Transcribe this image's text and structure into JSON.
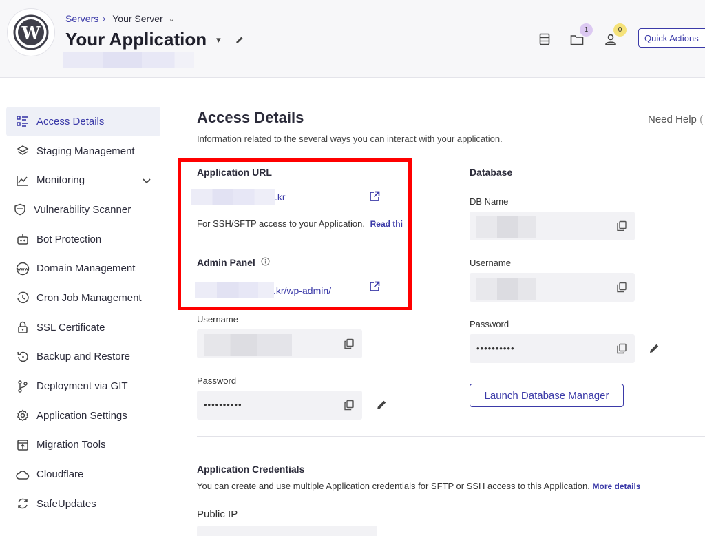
{
  "header": {
    "breadcrumb_servers": "Servers",
    "breadcrumb_server": "Your Server",
    "app_title": "Your Application",
    "notifications_count": "1",
    "users_count": "0",
    "quick_actions": "Quick Actions"
  },
  "sidebar": {
    "items": [
      {
        "label": "Access Details",
        "icon": "list-icon"
      },
      {
        "label": "Staging Management",
        "icon": "layers-icon"
      },
      {
        "label": "Monitoring",
        "icon": "chart-icon"
      },
      {
        "label": "Vulnerability Scanner",
        "icon": "shield-scan-icon"
      },
      {
        "label": "Bot Protection",
        "icon": "bot-icon"
      },
      {
        "label": "Domain Management",
        "icon": "www-icon"
      },
      {
        "label": "Cron Job Management",
        "icon": "clock-icon"
      },
      {
        "label": "SSL Certificate",
        "icon": "lock-icon"
      },
      {
        "label": "Backup and Restore",
        "icon": "restore-icon"
      },
      {
        "label": "Deployment via GIT",
        "icon": "git-icon"
      },
      {
        "label": "Application Settings",
        "icon": "gear-icon"
      },
      {
        "label": "Migration Tools",
        "icon": "migration-icon"
      },
      {
        "label": "Cloudflare",
        "icon": "cloud-icon"
      },
      {
        "label": "SafeUpdates",
        "icon": "refresh-icon"
      }
    ]
  },
  "main": {
    "title": "Access Details",
    "subtitle": "Information related to the several ways you can interact with your application.",
    "need_help": "Need Help",
    "app_url": {
      "label": "Application URL",
      "url_suffix": ".kr",
      "ssh_note": "For SSH/SFTP access to your Application.",
      "read_link": "Read thi"
    },
    "admin_panel": {
      "label": "Admin Panel",
      "url_suffix": ".kr/wp-admin/"
    },
    "app_username_label": "Username",
    "app_password_label": "Password",
    "app_password_value": "••••••••••",
    "database": {
      "label": "Database",
      "db_name_label": "DB Name",
      "username_label": "Username",
      "password_label": "Password",
      "password_value": "••••••••••",
      "launch_button": "Launch Database Manager"
    },
    "credentials": {
      "title": "Application Credentials",
      "description": "You can create and use multiple Application credentials for SFTP or SSH access to this Application.",
      "more_link": "More details",
      "public_ip_label": "Public IP"
    }
  }
}
